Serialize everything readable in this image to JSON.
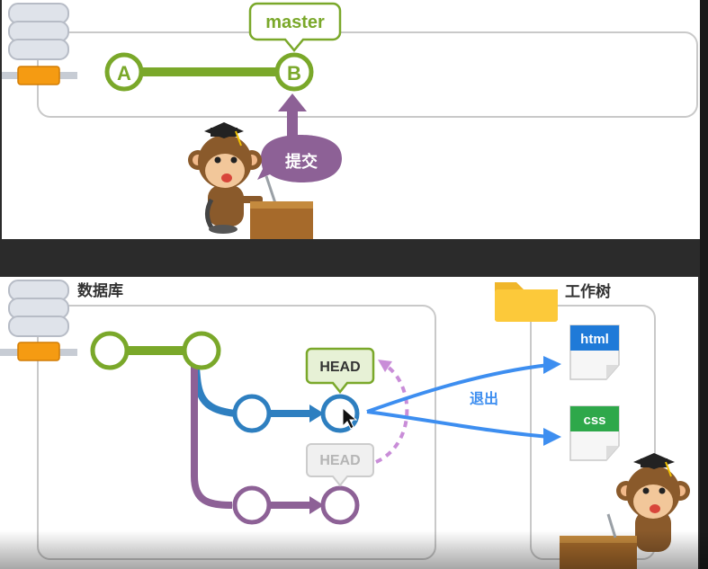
{
  "top": {
    "branch_label": "master",
    "commit_a": "A",
    "commit_b": "B",
    "commit_bubble": "提交"
  },
  "bottom": {
    "repo_label": "数据库",
    "worktree_label": "工作树",
    "head_active": "HEAD",
    "head_inactive": "HEAD",
    "checkout_label": "退出",
    "file_html": "html",
    "file_css": "css"
  },
  "colors": {
    "green": "#7aa82a",
    "blue": "#2e7fc0",
    "purple": "#8d6196",
    "arrow_blue": "#3d8ef0",
    "dashed_pink": "#c98dd8"
  }
}
